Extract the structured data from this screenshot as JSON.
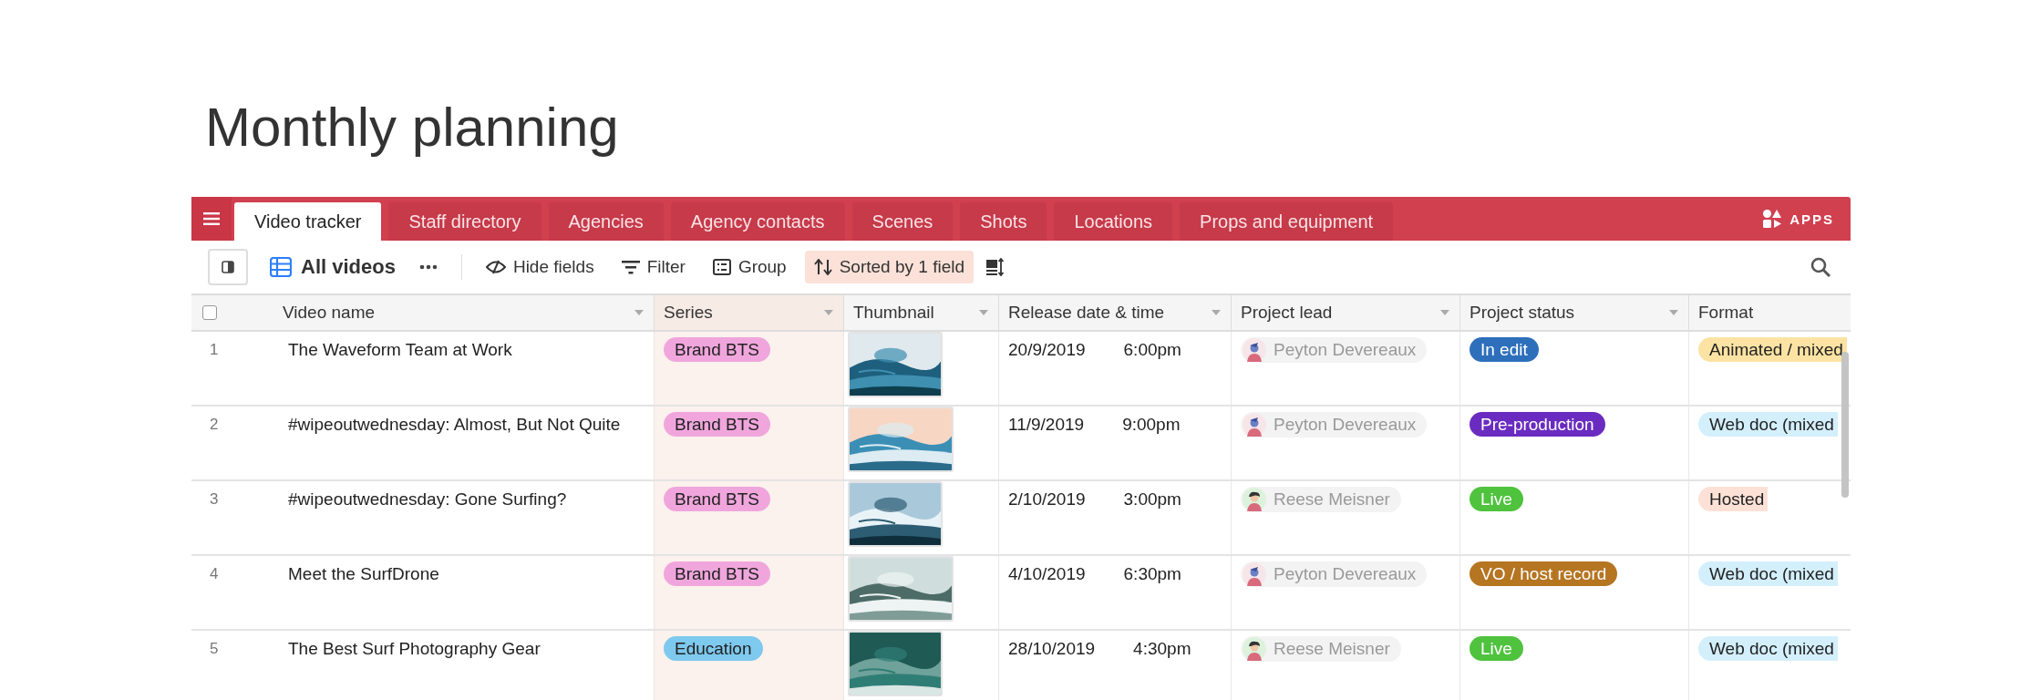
{
  "page_title": "Monthly planning",
  "tabs": [
    {
      "label": "Video tracker",
      "selected": true
    },
    {
      "label": "Staff directory",
      "selected": false
    },
    {
      "label": "Agencies",
      "selected": false
    },
    {
      "label": "Agency contacts",
      "selected": false
    },
    {
      "label": "Scenes",
      "selected": false
    },
    {
      "label": "Shots",
      "selected": false
    },
    {
      "label": "Locations",
      "selected": false
    },
    {
      "label": "Props and equipment",
      "selected": false
    }
  ],
  "apps_label": "APPS",
  "toolbar": {
    "view_name": "All videos",
    "buttons": [
      {
        "label": "Hide fields",
        "kind": "hide",
        "active": false
      },
      {
        "label": "Filter",
        "kind": "filter",
        "active": false
      },
      {
        "label": "Group",
        "kind": "group",
        "active": false
      },
      {
        "label": "Sorted by 1 field",
        "kind": "sort",
        "active": true
      }
    ]
  },
  "table": {
    "select_all": {
      "checked": false
    },
    "columns": [
      {
        "label": "Video name",
        "sorted": false
      },
      {
        "label": "Series",
        "sorted": true
      },
      {
        "label": "Thumbnail",
        "sorted": false
      },
      {
        "label": "Release date & time",
        "sorted": false
      },
      {
        "label": "Project lead",
        "sorted": false
      },
      {
        "label": "Project status",
        "sorted": false
      },
      {
        "label": "Format",
        "sorted": false
      }
    ],
    "rows": [
      {
        "number": "1",
        "name": "The Waveform Team at Work",
        "series": {
          "label": "Brand BTS",
          "color": "#f0a6dc"
        },
        "date": "20/9/2019",
        "time": "6:00pm",
        "lead": {
          "name": "Peyton Devereaux",
          "kind": "peyton"
        },
        "status": {
          "label": "In edit",
          "color": "#2d6fbb"
        },
        "format": {
          "label": "Animated / mixed",
          "color": "#fde3a3"
        }
      },
      {
        "number": "2",
        "name": "#wipeoutwednesday: Almost, But Not Quite",
        "series": {
          "label": "Brand BTS",
          "color": "#f0a6dc"
        },
        "date": "11/9/2019",
        "time": "9:00pm",
        "lead": {
          "name": "Peyton Devereaux",
          "kind": "peyton"
        },
        "status": {
          "label": "Pre-production",
          "color": "#6a2cc0"
        },
        "format": {
          "label": "Web doc (mixed",
          "color": "#d3effc"
        }
      },
      {
        "number": "3",
        "name": "#wipeoutwednesday: Gone Surfing?",
        "series": {
          "label": "Brand BTS",
          "color": "#f0a6dc"
        },
        "date": "2/10/2019",
        "time": "3:00pm",
        "lead": {
          "name": "Reese Meisner",
          "kind": "reese"
        },
        "status": {
          "label": "Live",
          "color": "#4fc23e"
        },
        "format": {
          "label": "Hosted",
          "color": "#fde1d7"
        }
      },
      {
        "number": "4",
        "name": "Meet the SurfDrone",
        "series": {
          "label": "Brand BTS",
          "color": "#f0a6dc"
        },
        "date": "4/10/2019",
        "time": "6:30pm",
        "lead": {
          "name": "Peyton Devereaux",
          "kind": "peyton"
        },
        "status": {
          "label": "VO / host record",
          "color": "#b57521"
        },
        "format": {
          "label": "Web doc (mixed",
          "color": "#d3effc"
        }
      },
      {
        "number": "5",
        "name": "The Best Surf Photography Gear",
        "series": {
          "label": "Education",
          "color": "#7ec9ee"
        },
        "date": "28/10/2019",
        "time": "4:30pm",
        "lead": {
          "name": "Reese Meisner",
          "kind": "reese"
        },
        "status": {
          "label": "Live",
          "color": "#4fc23e"
        },
        "format": {
          "label": "Web doc (mixed",
          "color": "#d3effc"
        }
      }
    ]
  }
}
